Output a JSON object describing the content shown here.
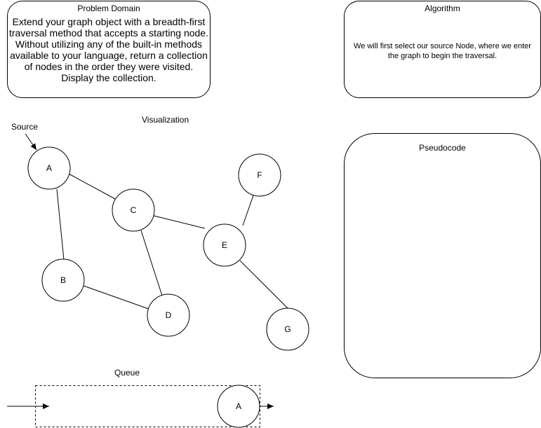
{
  "problem": {
    "title": "Problem Domain",
    "lines": [
      "Extend your graph object with a breadth-first",
      "traversal method that accepts a starting node.",
      "Without utilizing any of the built-in methods",
      "available to your language, return a collection",
      "of nodes in the order they were visited.",
      "Display the collection."
    ]
  },
  "algorithm": {
    "title": "Algorithm",
    "lines": [
      "We will first select our source Node, where we enter",
      "the graph to begin the traversal."
    ]
  },
  "pseudocode": {
    "title": "Pseudocode",
    "body": ""
  },
  "visualization": {
    "title": "Visualization",
    "source_label": "Source",
    "nodes": [
      "A",
      "B",
      "C",
      "D",
      "E",
      "F",
      "G"
    ],
    "edges": [
      [
        "A",
        "C"
      ],
      [
        "A",
        "B"
      ],
      [
        "C",
        "E"
      ],
      [
        "C",
        "D"
      ],
      [
        "B",
        "D"
      ],
      [
        "E",
        "F"
      ],
      [
        "E",
        "G"
      ]
    ]
  },
  "queue": {
    "title": "Queue",
    "items": [
      "A"
    ]
  }
}
